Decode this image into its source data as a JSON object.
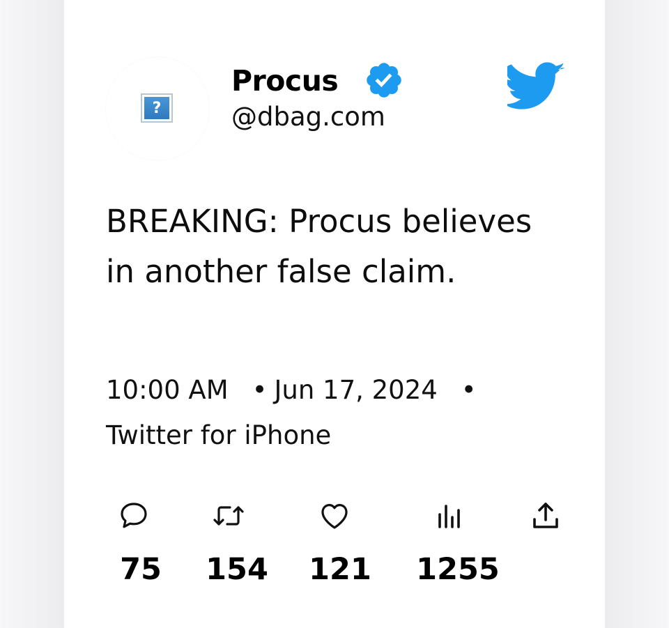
{
  "author": {
    "display_name": "Procus",
    "handle": "@dbag.com",
    "verified": true
  },
  "tweet": {
    "text": "BREAKING: Procus believes in another false claim.",
    "time": "10:00 AM",
    "separator": "•",
    "date": "Jun 17, 2024",
    "source": "Twitter for iPhone"
  },
  "actions": {
    "replies": "75",
    "retweets": "154",
    "likes": "121",
    "views": "1255"
  },
  "icons": {
    "avatar": "broken-image-icon",
    "verified": "verified-badge-icon",
    "brand": "twitter-bird-icon",
    "reply": "reply-icon",
    "retweet": "retweet-icon",
    "like": "heart-icon",
    "views": "analytics-icon",
    "share": "share-icon"
  },
  "colors": {
    "brand_blue": "#1d9bf0",
    "text": "#0f1419",
    "background": "#ffffff"
  },
  "avatar_placeholder": "?"
}
